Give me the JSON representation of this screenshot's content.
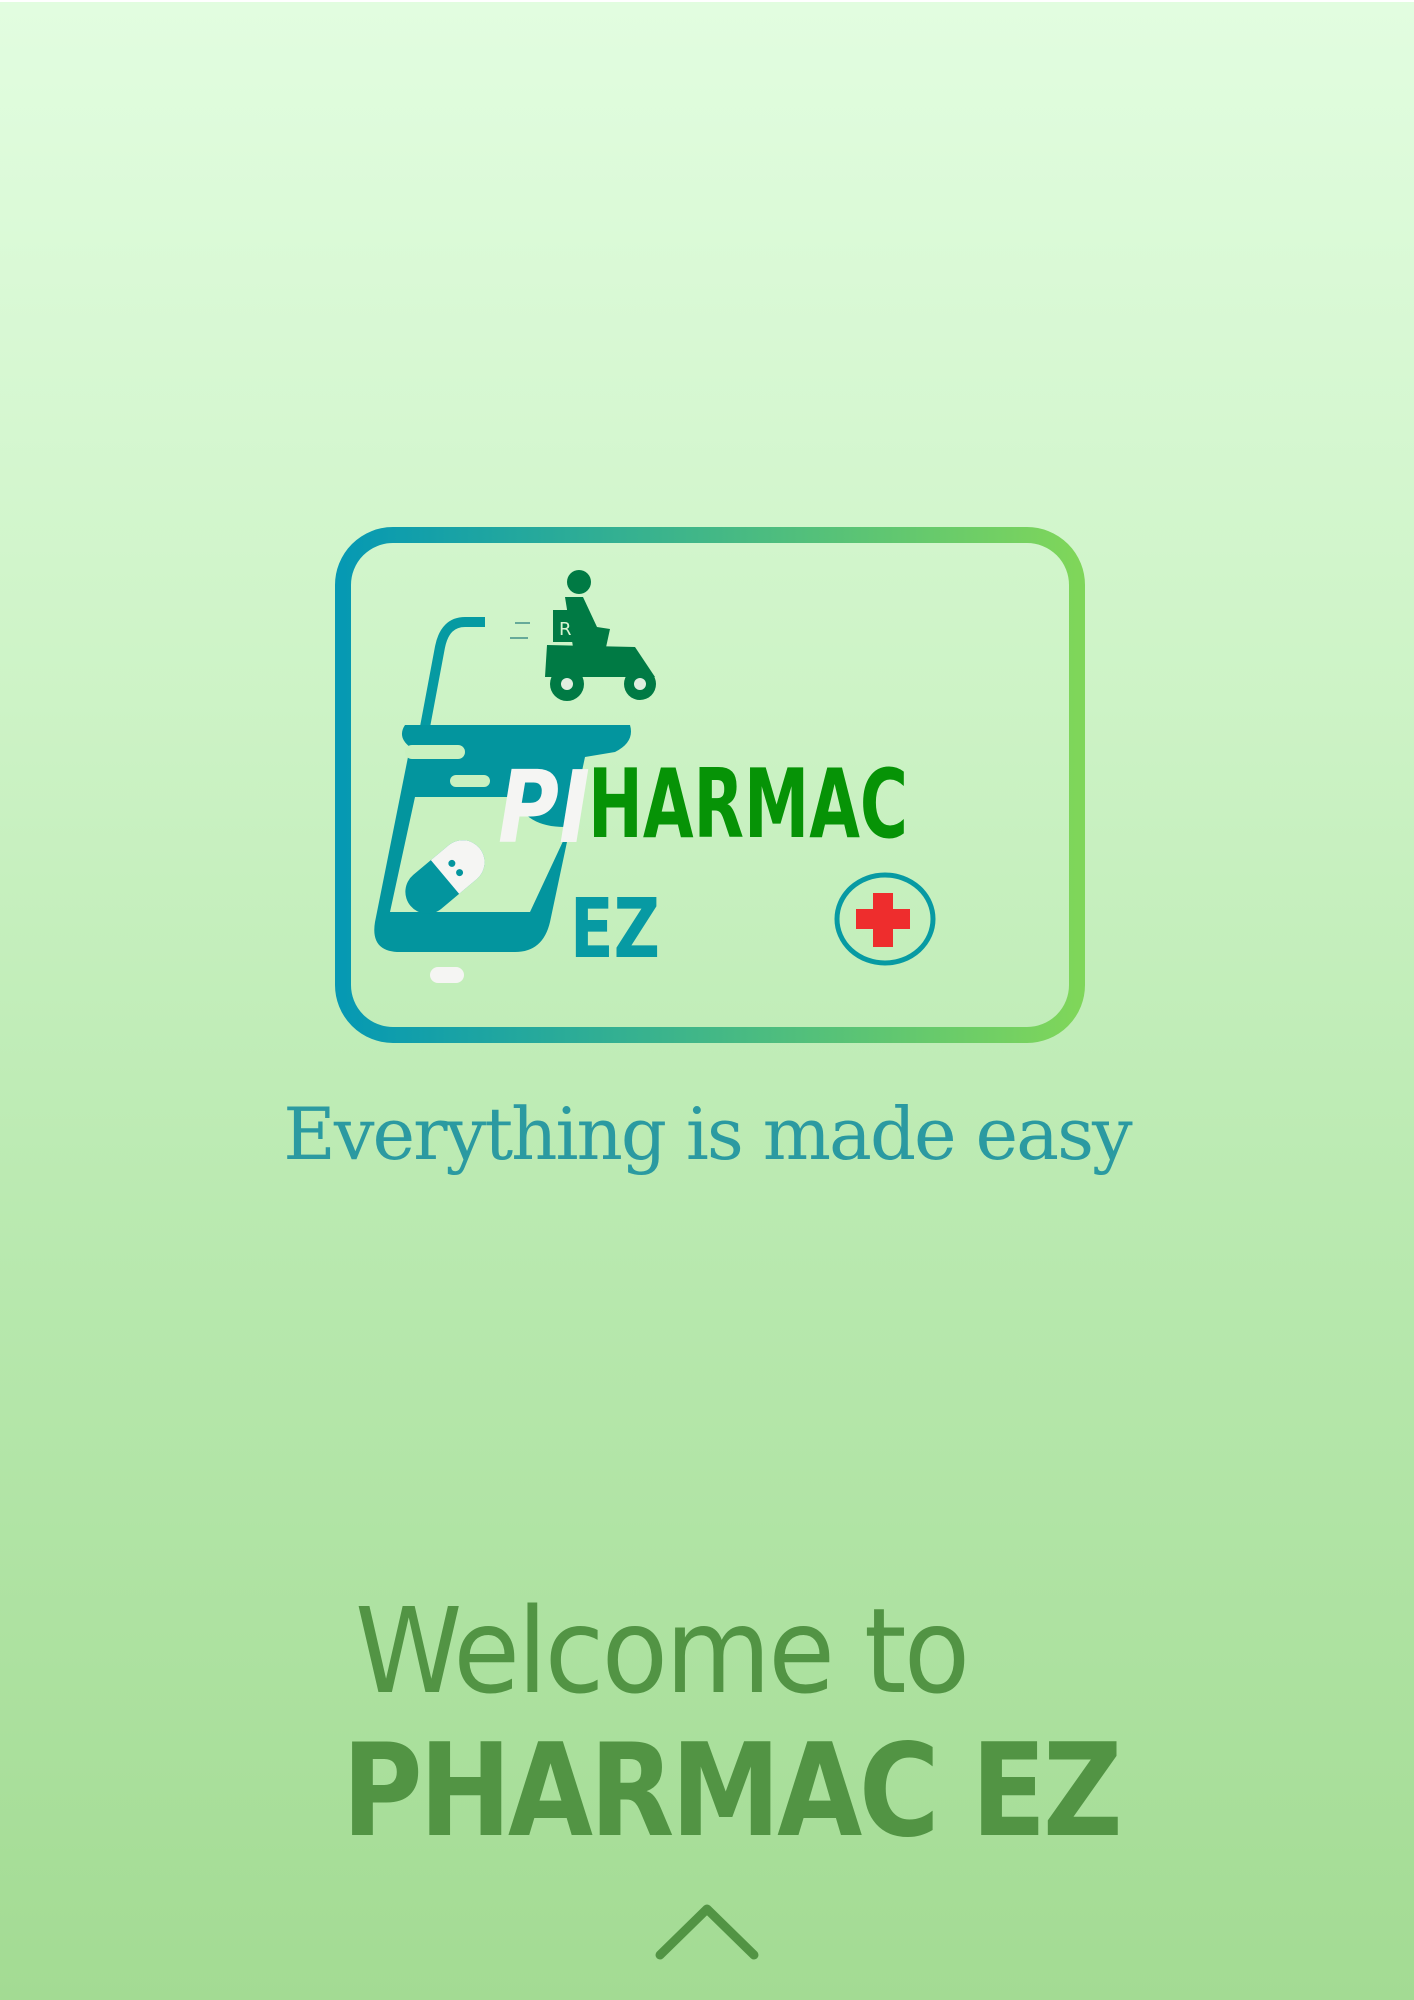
{
  "logo": {
    "text_top": "PHARMAC",
    "text_bottom": "EZ",
    "badge": "Rx"
  },
  "tagline": "Everything is made easy",
  "welcome": {
    "line1": "Welcome to",
    "line2": "PHARMAC EZ"
  },
  "colors": {
    "brand_green": "#529444",
    "teal": "#03959e",
    "logo_green": "#069306",
    "cross_red": "#ee2d2d"
  },
  "icons": {
    "scroll": "chevron-up-icon"
  }
}
